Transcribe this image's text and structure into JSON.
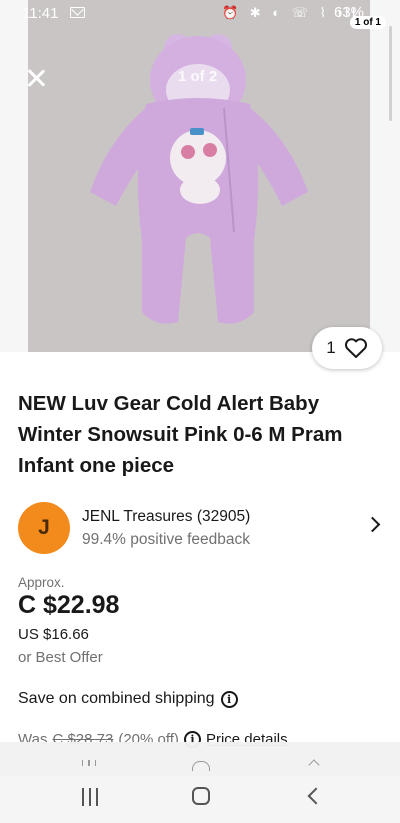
{
  "status_bar": {
    "time": "11:41",
    "battery": "63%",
    "icons": "⏰ ✱ ◐ ☏ ⌇ ıll",
    "counter": "1 of 1"
  },
  "gallery": {
    "photo_counter": "1 of 2",
    "watch_count": "1"
  },
  "listing": {
    "title": "NEW Luv Gear Cold Alert Baby Winter Snowsuit Pink 0-6 M Pram Infant one piece"
  },
  "seller": {
    "initial": "J",
    "name": "JENL Treasures (32905)",
    "feedback": "99.4% positive feedback",
    "avatar_color": "#f28b1c"
  },
  "pricing": {
    "approx_label": "Approx.",
    "price": "C $22.98",
    "usd": "US $16.66",
    "best_offer": "or Best Offer",
    "shipping": "Save on combined shipping",
    "was_label": "Was",
    "was_price": "C $28.73",
    "discount": "(20% off)",
    "price_details": "Price details"
  },
  "colors": {
    "snowsuit": "#cfa9dc",
    "photo_background": "#c9c5c5",
    "text_primary": "#191919",
    "text_secondary": "#707070"
  },
  "icons": [
    "close-icon",
    "heart-icon",
    "chevron-right-icon",
    "info-icon",
    "recents-icon",
    "home-icon",
    "back-icon"
  ]
}
